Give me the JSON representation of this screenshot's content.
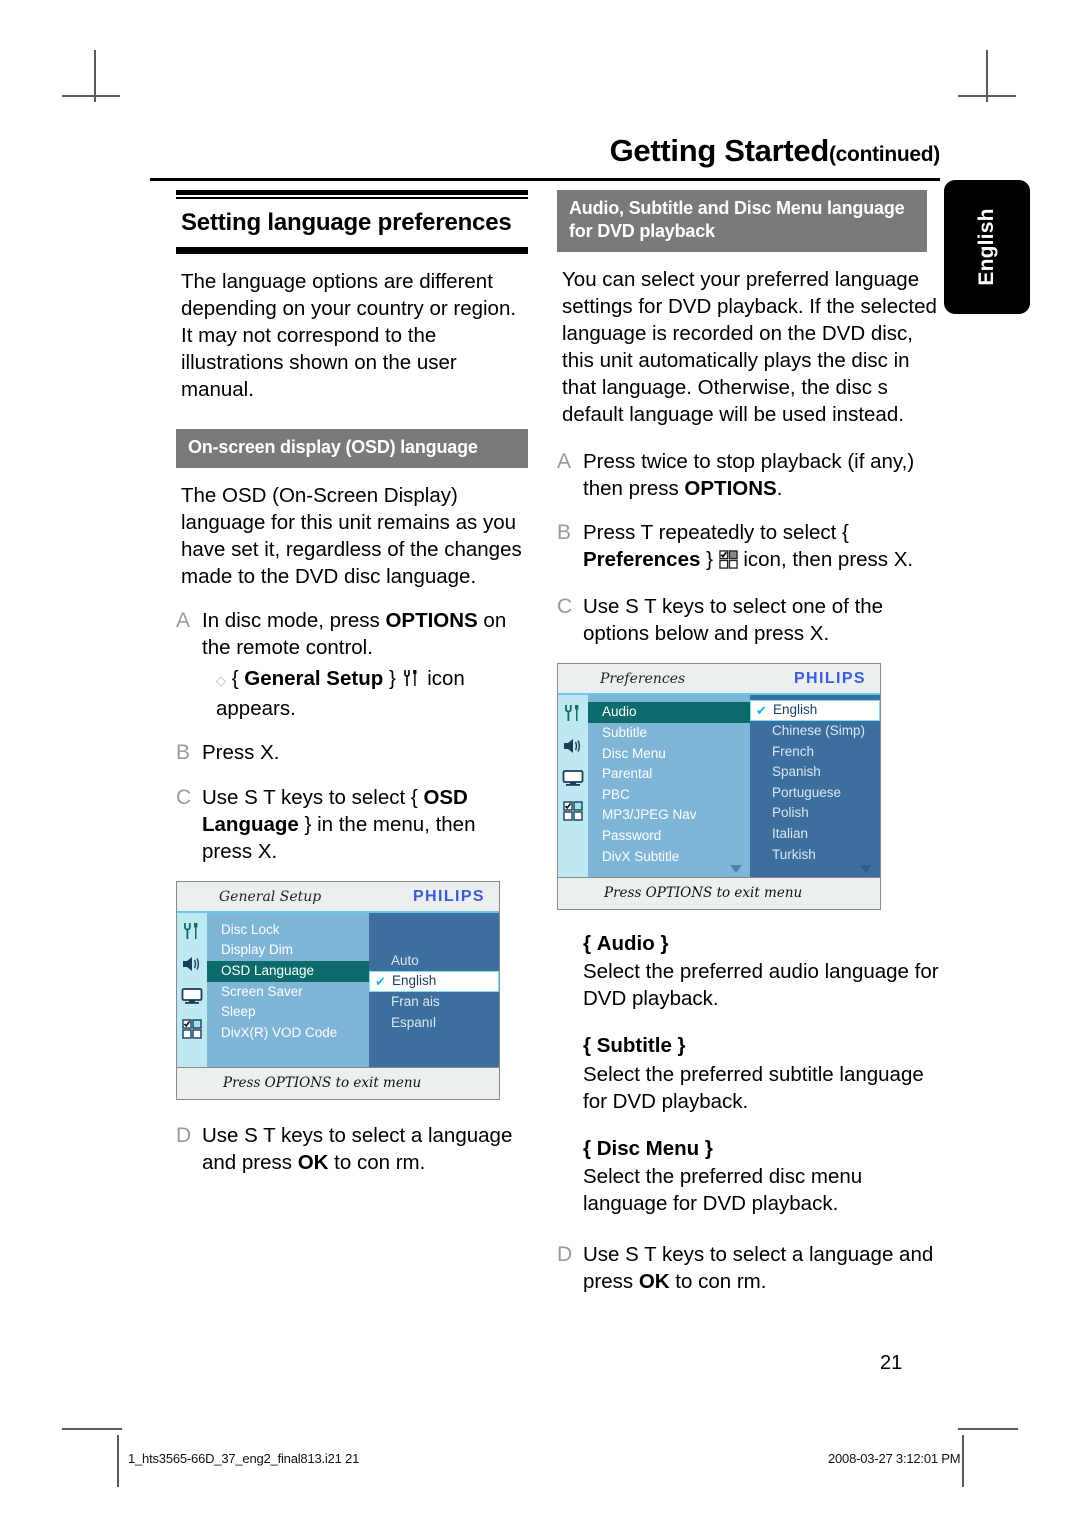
{
  "header": {
    "title": "Getting Started",
    "continued": "(continued)"
  },
  "side_tab": {
    "label": "English"
  },
  "left_column": {
    "section_title": "Setting language preferences",
    "intro": "The language options are different depending on your country or region. It may not correspond to the illustrations shown on the user manual.",
    "subhead": "On-screen display (OSD) language",
    "paragraph": "The OSD (On-Screen Display) language for this unit remains as you have set it, regardless of the changes made to the DVD disc language.",
    "steps": [
      {
        "marker": "A",
        "text_before": "In disc mode, press ",
        "bold": "OPTIONS",
        "text_after": " on the remote control.",
        "note_before": "{ ",
        "note_bold": "General Setup",
        "note_after": " }",
        "note_icon": "tools-icon",
        "note_tail": " icon appears."
      },
      {
        "marker": "B",
        "text_before": "Press ",
        "bold": "",
        "text_after": "X."
      },
      {
        "marker": "C",
        "text_before": "Use S T keys to select { ",
        "bold": "OSD Language",
        "text_after": " } in the menu, then press X."
      },
      {
        "marker": "D",
        "text_before": "Use S T keys to select a language and press ",
        "bold": "OK",
        "text_after": " to con rm."
      }
    ],
    "screenshot": {
      "title": "General Setup",
      "brand": "PHILIPS",
      "sidebar_icons": [
        "tools-icon",
        "speaker-icon",
        "tv-icon",
        "preferences-grid-icon"
      ],
      "menu_items": [
        "Disc Lock",
        "Display Dim",
        "OSD Language",
        "Screen Saver",
        "Sleep",
        "DivX(R) VOD Code"
      ],
      "menu_selected": "OSD Language",
      "options": [
        "Auto",
        "English",
        "Fran ais",
        "Espanıl"
      ],
      "option_selected": "English",
      "footer": "Press OPTIONS to exit menu"
    }
  },
  "right_column": {
    "subhead": "Audio, Subtitle and Disc Menu language for DVD playback",
    "intro": "You can select your preferred language settings for DVD playback. If the selected language is recorded on the DVD disc, this unit automatically plays the disc in that language. Otherwise, the disc s default language will be used instead.",
    "steps": [
      {
        "marker": "A",
        "text_before": "Press  twice to stop playback (if any,) then press ",
        "bold": "OPTIONS",
        "text_after": "."
      },
      {
        "marker": "B",
        "text_before": "Press T repeatedly to select { ",
        "bold": "Preferences",
        "text_after": " }",
        "icon": "preferences-grid-icon",
        "text_tail": " icon, then press X."
      },
      {
        "marker": "C",
        "text_before": "Use S T keys to select one of the options below and press X.",
        "bold": "",
        "text_after": ""
      },
      {
        "marker": "D",
        "text_before": "Use S T keys to select a language and press ",
        "bold": "OK",
        "text_after": " to con rm."
      }
    ],
    "screenshot": {
      "title": "Preferences",
      "brand": "PHILIPS",
      "sidebar_icons": [
        "tools-icon",
        "speaker-icon",
        "tv-icon",
        "preferences-grid-icon"
      ],
      "menu_items": [
        "Audio",
        "Subtitle",
        "Disc Menu",
        "Parental",
        "PBC",
        "MP3/JPEG Nav",
        "Password",
        "DivX Subtitle"
      ],
      "menu_selected": "Audio",
      "options": [
        "English",
        "Chinese (Simp)",
        "French",
        "Spanish",
        "Portuguese",
        "Polish",
        "Italian",
        "Turkish"
      ],
      "option_selected": "English",
      "footer": "Press OPTIONS to exit menu"
    },
    "definitions": [
      {
        "term_open": "{ ",
        "term": "Audio",
        "term_close": " }",
        "desc": "Select the preferred audio language for DVD playback."
      },
      {
        "term_open": "{ ",
        "term": "Subtitle",
        "term_close": " }",
        "desc": "Select the preferred subtitle language for DVD playback."
      },
      {
        "term_open": "{ ",
        "term": "Disc Menu",
        "term_close": " }",
        "desc": "Select the preferred disc menu language for DVD playback."
      }
    ]
  },
  "page_number": "21",
  "footer": {
    "file": "1_hts3565-66D_37_eng2_final813.i21   21",
    "timestamp": "2008-03-27   3:12:01 PM"
  },
  "colors": {
    "brand_blue": "#3b5bdb",
    "bar_gray": "#7a7a7a",
    "menu_blue": "#7fb5d6",
    "option_panel": "#3d6f9e",
    "selected_teal": "#0c6b6b",
    "icon_panel": "#bfe9f2"
  }
}
